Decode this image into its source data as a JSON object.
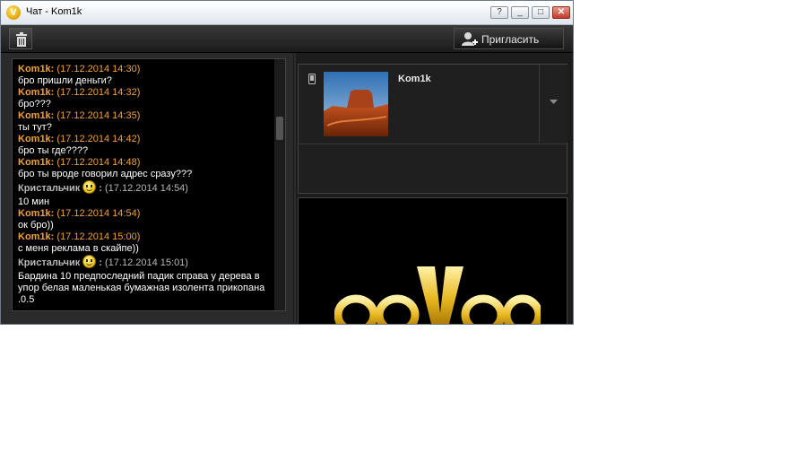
{
  "window": {
    "title": "Чат - Kom1k"
  },
  "titlebar_buttons": {
    "help": "?",
    "minimize": "_",
    "maximize": "□",
    "close": "✕"
  },
  "toolbar": {
    "invite_label": "Пригласить"
  },
  "chat": {
    "messages": [
      {
        "sender": "Kom1k:",
        "timestamp": "(17.12.2014 14:30)",
        "text": "бро пришли деньги?",
        "style": "orange"
      },
      {
        "sender": "Kom1k:",
        "timestamp": "(17.12.2014 14:32)",
        "text": "бро???",
        "style": "orange"
      },
      {
        "sender": "Kom1k:",
        "timestamp": "(17.12.2014 14:35)",
        "text": "ты тут?",
        "style": "orange"
      },
      {
        "sender": "Kom1k:",
        "timestamp": "(17.12.2014 14:42)",
        "text": "бро ты где????",
        "style": "orange"
      },
      {
        "sender": "Kom1k:",
        "timestamp": "(17.12.2014 14:48)",
        "text": "бро ты вроде говорил адрес сразу???",
        "style": "orange"
      },
      {
        "sender": "Кристальчик",
        "timestamp": "(17.12.2014 14:54)",
        "text": "10 мин",
        "style": "gray"
      },
      {
        "sender": "Kom1k:",
        "timestamp": "(17.12.2014 14:54)",
        "text": "ок бро))",
        "style": "orange"
      },
      {
        "sender": "Kom1k:",
        "timestamp": "(17.12.2014 15:00)",
        "text": "с меня реклама в скайпе))",
        "style": "orange"
      },
      {
        "sender": "Кристальчик",
        "timestamp": "(17.12.2014 15:01)",
        "text_lines": [
          "Бардина 10  предпоследний падик  справа у дерева в",
          "упор белая маленькая бумажная изолента прикопана",
          ".0.5"
        ],
        "style": "gray"
      }
    ]
  },
  "contact": {
    "name": "Kom1k"
  },
  "brand": {
    "logo_text": "ooVoo"
  },
  "icons": {
    "app": "oovoo-logo-icon",
    "trash": "trash-icon",
    "invite": "add-user-icon",
    "phone": "mobile-phone-icon",
    "expand": "chevron-down-icon",
    "smiley": "smiley-icon"
  },
  "colors": {
    "sender_orange": "#f2a030",
    "sender_gray": "#b8b8b8",
    "brand_gold": "#e8b820"
  }
}
